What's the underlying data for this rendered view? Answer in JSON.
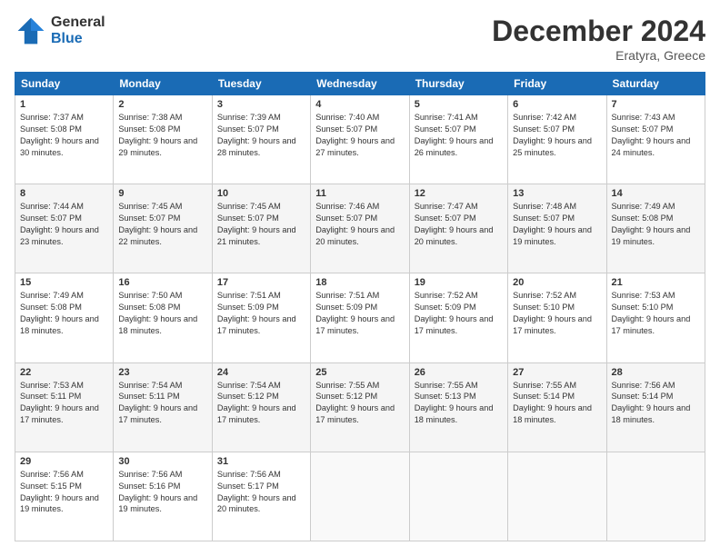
{
  "logo": {
    "general": "General",
    "blue": "Blue"
  },
  "header": {
    "month_year": "December 2024",
    "location": "Eratyra, Greece"
  },
  "weekdays": [
    "Sunday",
    "Monday",
    "Tuesday",
    "Wednesday",
    "Thursday",
    "Friday",
    "Saturday"
  ],
  "weeks": [
    [
      {
        "day": "1",
        "sunrise": "7:37 AM",
        "sunset": "5:08 PM",
        "daylight": "9 hours and 30 minutes."
      },
      {
        "day": "2",
        "sunrise": "7:38 AM",
        "sunset": "5:08 PM",
        "daylight": "9 hours and 29 minutes."
      },
      {
        "day": "3",
        "sunrise": "7:39 AM",
        "sunset": "5:07 PM",
        "daylight": "9 hours and 28 minutes."
      },
      {
        "day": "4",
        "sunrise": "7:40 AM",
        "sunset": "5:07 PM",
        "daylight": "9 hours and 27 minutes."
      },
      {
        "day": "5",
        "sunrise": "7:41 AM",
        "sunset": "5:07 PM",
        "daylight": "9 hours and 26 minutes."
      },
      {
        "day": "6",
        "sunrise": "7:42 AM",
        "sunset": "5:07 PM",
        "daylight": "9 hours and 25 minutes."
      },
      {
        "day": "7",
        "sunrise": "7:43 AM",
        "sunset": "5:07 PM",
        "daylight": "9 hours and 24 minutes."
      }
    ],
    [
      {
        "day": "8",
        "sunrise": "7:44 AM",
        "sunset": "5:07 PM",
        "daylight": "9 hours and 23 minutes."
      },
      {
        "day": "9",
        "sunrise": "7:45 AM",
        "sunset": "5:07 PM",
        "daylight": "9 hours and 22 minutes."
      },
      {
        "day": "10",
        "sunrise": "7:45 AM",
        "sunset": "5:07 PM",
        "daylight": "9 hours and 21 minutes."
      },
      {
        "day": "11",
        "sunrise": "7:46 AM",
        "sunset": "5:07 PM",
        "daylight": "9 hours and 20 minutes."
      },
      {
        "day": "12",
        "sunrise": "7:47 AM",
        "sunset": "5:07 PM",
        "daylight": "9 hours and 20 minutes."
      },
      {
        "day": "13",
        "sunrise": "7:48 AM",
        "sunset": "5:07 PM",
        "daylight": "9 hours and 19 minutes."
      },
      {
        "day": "14",
        "sunrise": "7:49 AM",
        "sunset": "5:08 PM",
        "daylight": "9 hours and 19 minutes."
      }
    ],
    [
      {
        "day": "15",
        "sunrise": "7:49 AM",
        "sunset": "5:08 PM",
        "daylight": "9 hours and 18 minutes."
      },
      {
        "day": "16",
        "sunrise": "7:50 AM",
        "sunset": "5:08 PM",
        "daylight": "9 hours and 18 minutes."
      },
      {
        "day": "17",
        "sunrise": "7:51 AM",
        "sunset": "5:09 PM",
        "daylight": "9 hours and 17 minutes."
      },
      {
        "day": "18",
        "sunrise": "7:51 AM",
        "sunset": "5:09 PM",
        "daylight": "9 hours and 17 minutes."
      },
      {
        "day": "19",
        "sunrise": "7:52 AM",
        "sunset": "5:09 PM",
        "daylight": "9 hours and 17 minutes."
      },
      {
        "day": "20",
        "sunrise": "7:52 AM",
        "sunset": "5:10 PM",
        "daylight": "9 hours and 17 minutes."
      },
      {
        "day": "21",
        "sunrise": "7:53 AM",
        "sunset": "5:10 PM",
        "daylight": "9 hours and 17 minutes."
      }
    ],
    [
      {
        "day": "22",
        "sunrise": "7:53 AM",
        "sunset": "5:11 PM",
        "daylight": "9 hours and 17 minutes."
      },
      {
        "day": "23",
        "sunrise": "7:54 AM",
        "sunset": "5:11 PM",
        "daylight": "9 hours and 17 minutes."
      },
      {
        "day": "24",
        "sunrise": "7:54 AM",
        "sunset": "5:12 PM",
        "daylight": "9 hours and 17 minutes."
      },
      {
        "day": "25",
        "sunrise": "7:55 AM",
        "sunset": "5:12 PM",
        "daylight": "9 hours and 17 minutes."
      },
      {
        "day": "26",
        "sunrise": "7:55 AM",
        "sunset": "5:13 PM",
        "daylight": "9 hours and 18 minutes."
      },
      {
        "day": "27",
        "sunrise": "7:55 AM",
        "sunset": "5:14 PM",
        "daylight": "9 hours and 18 minutes."
      },
      {
        "day": "28",
        "sunrise": "7:56 AM",
        "sunset": "5:14 PM",
        "daylight": "9 hours and 18 minutes."
      }
    ],
    [
      {
        "day": "29",
        "sunrise": "7:56 AM",
        "sunset": "5:15 PM",
        "daylight": "9 hours and 19 minutes."
      },
      {
        "day": "30",
        "sunrise": "7:56 AM",
        "sunset": "5:16 PM",
        "daylight": "9 hours and 19 minutes."
      },
      {
        "day": "31",
        "sunrise": "7:56 AM",
        "sunset": "5:17 PM",
        "daylight": "9 hours and 20 minutes."
      },
      null,
      null,
      null,
      null
    ]
  ]
}
